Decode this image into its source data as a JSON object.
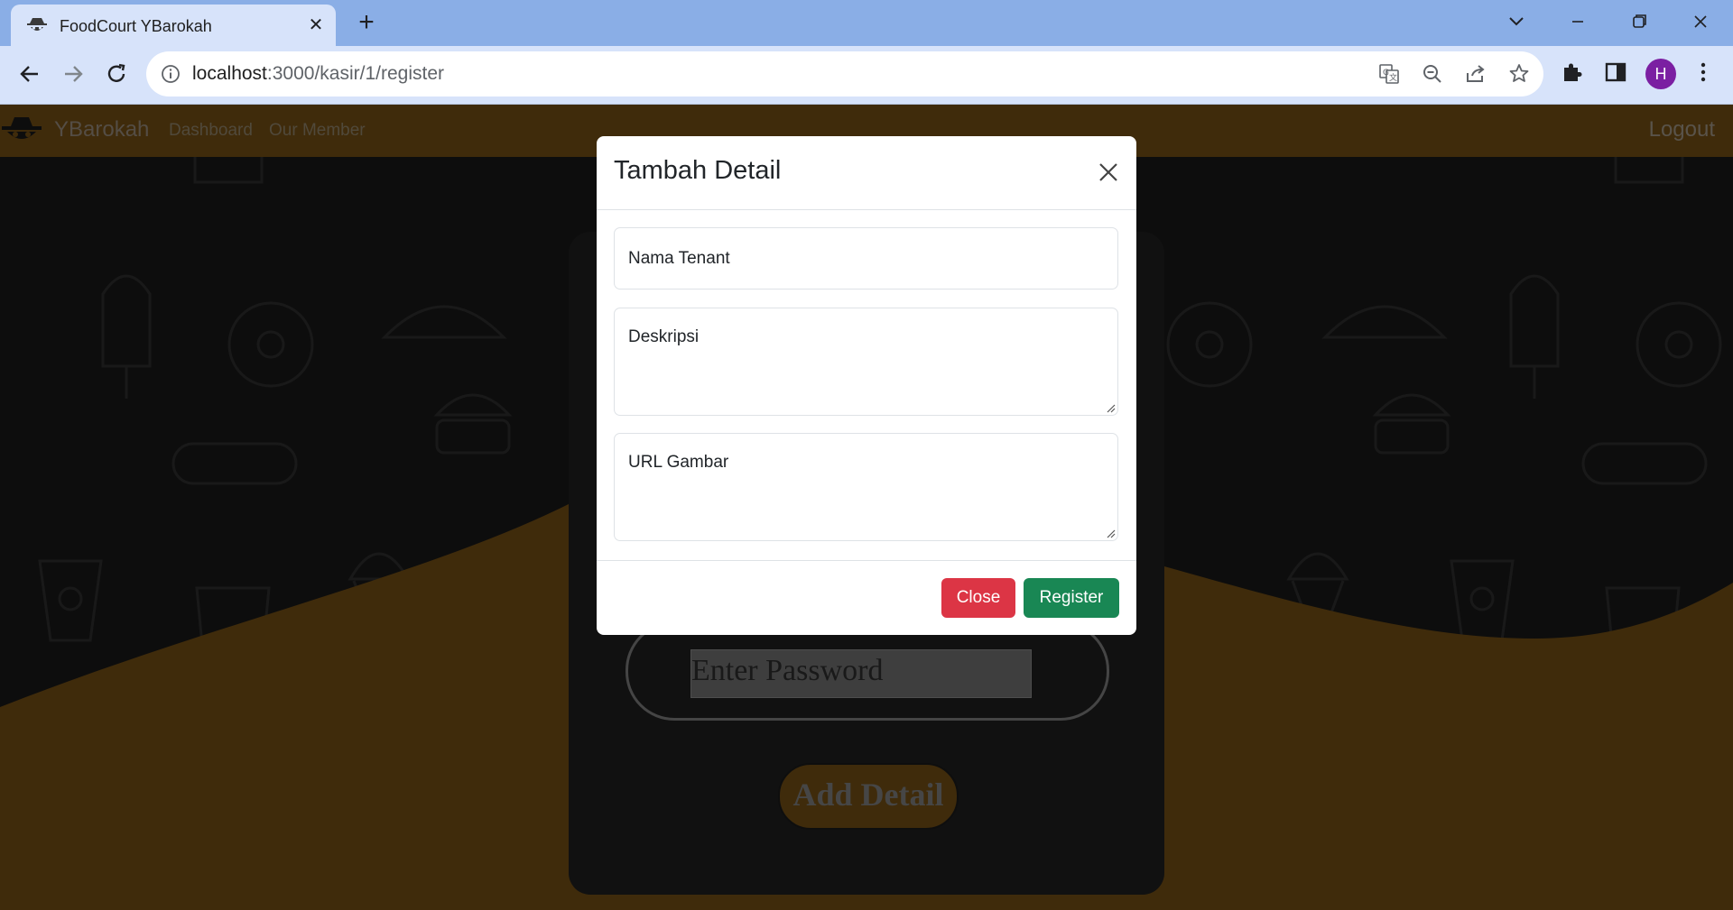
{
  "browser": {
    "tab_title": "FoodCourt YBarokah",
    "url_host": "localhost",
    "url_path": ":3000/kasir/1/register",
    "profile_initial": "H"
  },
  "navbar": {
    "brand": "YBarokah",
    "links": [
      "Dashboard",
      "Our Member"
    ],
    "logout": "Logout",
    "color": "#7f5617"
  },
  "form": {
    "password_placeholder": "Enter Password",
    "add_detail_label": "Add Detail"
  },
  "modal": {
    "title": "Tambah Detail",
    "fields": {
      "nama_tenant": "Nama Tenant",
      "deskripsi": "Deskripsi",
      "url_gambar": "URL Gambar"
    },
    "buttons": {
      "close": "Close",
      "register": "Register"
    },
    "colors": {
      "close": "#dc3545",
      "register": "#198754"
    }
  }
}
